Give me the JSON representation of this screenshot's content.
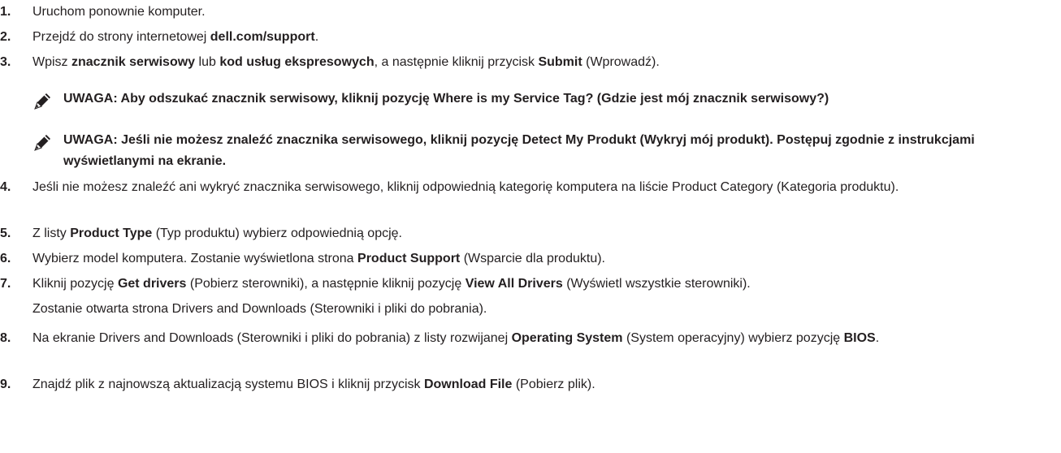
{
  "steps": [
    {
      "num": "1.",
      "parts": [
        {
          "t": "Uruchom ponownie komputer.",
          "b": false
        }
      ]
    },
    {
      "num": "2.",
      "parts": [
        {
          "t": "Przejdź do strony internetowej ",
          "b": false
        },
        {
          "t": "dell.com/support",
          "b": true
        },
        {
          "t": ".",
          "b": false
        }
      ]
    },
    {
      "num": "3.",
      "parts": [
        {
          "t": "Wpisz ",
          "b": false
        },
        {
          "t": "znacznik serwisowy",
          "b": true
        },
        {
          "t": " lub ",
          "b": false
        },
        {
          "t": "kod usług ekspresowych",
          "b": true
        },
        {
          "t": ", a następnie kliknij przycisk ",
          "b": false
        },
        {
          "t": "Submit",
          "b": true
        },
        {
          "t": " (Wprowadź).",
          "b": false
        }
      ]
    },
    {
      "num": "4.",
      "parts": [
        {
          "t": "Jeśli nie możesz znaleźć ani wykryć znacznika serwisowego, kliknij odpowiednią kategorię komputera na liście Product Category (Kategoria produktu).",
          "b": false
        }
      ]
    },
    {
      "num": "5.",
      "parts": [
        {
          "t": "Z listy ",
          "b": false
        },
        {
          "t": "Product Type",
          "b": true
        },
        {
          "t": " (Typ produktu) wybierz odpowiednią opcję.",
          "b": false
        }
      ]
    },
    {
      "num": "6.",
      "parts": [
        {
          "t": "Wybierz model komputera. Zostanie wyświetlona strona ",
          "b": false
        },
        {
          "t": "Product Support",
          "b": true
        },
        {
          "t": " (Wsparcie dla produktu).",
          "b": false
        }
      ]
    },
    {
      "num": "7.",
      "parts": [
        {
          "t": "Kliknij pozycję ",
          "b": false
        },
        {
          "t": "Get drivers",
          "b": true
        },
        {
          "t": " (Pobierz sterowniki), a następnie kliknij pozycję ",
          "b": false
        },
        {
          "t": "View All Drivers",
          "b": true
        },
        {
          "t": " (Wyświetl wszystkie sterowniki).",
          "b": false
        }
      ]
    },
    {
      "num": "8.",
      "parts": [
        {
          "t": "Na ekranie Drivers and Downloads (Sterowniki i pliki do pobrania) z listy rozwijanej ",
          "b": false
        },
        {
          "t": "Operating System",
          "b": true
        },
        {
          "t": " (System operacyjny) wybierz pozycję ",
          "b": false
        },
        {
          "t": "BIOS",
          "b": true
        },
        {
          "t": ".",
          "b": false
        }
      ]
    },
    {
      "num": "9.",
      "parts": [
        {
          "t": "Znajdź plik z najnowszą aktualizacją systemu BIOS i kliknij przycisk ",
          "b": false
        },
        {
          "t": "Download File",
          "b": true
        },
        {
          "t": " (Pobierz plik).",
          "b": false
        }
      ]
    }
  ],
  "notes": [
    {
      "icon": "note-pencil-icon",
      "text": "UWAGA: Aby odszukać znacznik serwisowy, kliknij pozycję Where is my Service Tag? (Gdzie jest mój znacznik serwisowy?)"
    },
    {
      "icon": "note-pencil-icon",
      "text": "UWAGA: Jeśli nie możesz znaleźć znacznika serwisowego, kliknij pozycję Detect My Produkt (Wykryj mój produkt). Postępuj zgodnie z instrukcjami wyświetlanymi na ekranie."
    }
  ],
  "step7_continuation": "Zostanie otwarta strona Drivers and Downloads (Sterowniki i pliki do pobrania)."
}
